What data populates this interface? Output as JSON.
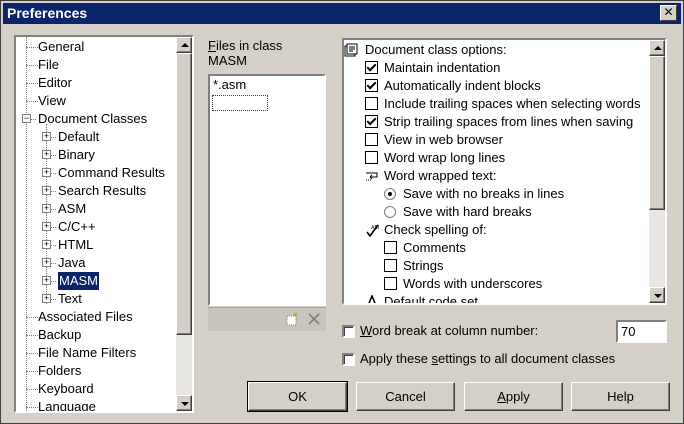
{
  "window": {
    "title": "Preferences",
    "close_glyph": "✕"
  },
  "tree": {
    "items": [
      {
        "label": "General",
        "level": 0,
        "expander": false
      },
      {
        "label": "File",
        "level": 0,
        "expander": false
      },
      {
        "label": "Editor",
        "level": 0,
        "expander": false
      },
      {
        "label": "View",
        "level": 0,
        "expander": false
      },
      {
        "label": "Document Classes",
        "level": 0,
        "expander": "−"
      },
      {
        "label": "Default",
        "level": 1,
        "expander": "+"
      },
      {
        "label": "Binary",
        "level": 1,
        "expander": "+"
      },
      {
        "label": "Command Results",
        "level": 1,
        "expander": "+"
      },
      {
        "label": "Search Results",
        "level": 1,
        "expander": "+"
      },
      {
        "label": "ASM",
        "level": 1,
        "expander": "+"
      },
      {
        "label": "C/C++",
        "level": 1,
        "expander": "+"
      },
      {
        "label": "HTML",
        "level": 1,
        "expander": "+"
      },
      {
        "label": "Java",
        "level": 1,
        "expander": "+"
      },
      {
        "label": "MASM",
        "level": 1,
        "expander": "+",
        "selected": true
      },
      {
        "label": "Text",
        "level": 1,
        "expander": "+"
      },
      {
        "label": "Associated Files",
        "level": 0,
        "expander": false
      },
      {
        "label": "Backup",
        "level": 0,
        "expander": false
      },
      {
        "label": "File Name Filters",
        "level": 0,
        "expander": false
      },
      {
        "label": "Folders",
        "level": 0,
        "expander": false
      },
      {
        "label": "Keyboard",
        "level": 0,
        "expander": false
      },
      {
        "label": "Language",
        "level": 0,
        "expander": false
      }
    ]
  },
  "files": {
    "label_prefix": "",
    "label_accel": "F",
    "label_rest": "iles in class",
    "class_name": "MASM",
    "items": [
      "*.asm"
    ],
    "new_icon": "new-item-icon",
    "delete_icon": "delete-icon"
  },
  "options": {
    "header": "Document class options:",
    "rows": [
      {
        "type": "checkbox",
        "label": "Maintain indentation",
        "checked": true,
        "indent": 1
      },
      {
        "type": "checkbox",
        "label": "Automatically indent blocks",
        "checked": true,
        "indent": 1
      },
      {
        "type": "checkbox",
        "label": "Include trailing spaces when selecting words",
        "checked": false,
        "indent": 1
      },
      {
        "type": "checkbox",
        "label": "Strip trailing spaces from lines when saving",
        "checked": true,
        "indent": 1
      },
      {
        "type": "checkbox",
        "label": "View in web browser",
        "checked": false,
        "indent": 1
      },
      {
        "type": "checkbox",
        "label": "Word wrap long lines",
        "checked": false,
        "indent": 1
      },
      {
        "type": "group",
        "label": "Word wrapped text:",
        "icon": "word-wrap-icon",
        "indent": 1
      },
      {
        "type": "radio",
        "label": "Save with no breaks in lines",
        "checked": true,
        "indent": 2
      },
      {
        "type": "radio",
        "label": "Save with hard breaks",
        "checked": false,
        "indent": 2
      },
      {
        "type": "group",
        "label": "Check spelling of:",
        "icon": "spell-check-icon",
        "indent": 1
      },
      {
        "type": "checkbox",
        "label": "Comments",
        "checked": false,
        "indent": 2
      },
      {
        "type": "checkbox",
        "label": "Strings",
        "checked": false,
        "indent": 2
      },
      {
        "type": "checkbox",
        "label": "Words with underscores",
        "checked": false,
        "indent": 2
      },
      {
        "type": "group",
        "label": "Default code set",
        "icon": "font-icon",
        "indent": 1
      }
    ]
  },
  "word_break": {
    "label_accel": "W",
    "label_rest": "ord break at column number:",
    "checked": false,
    "value": "70"
  },
  "apply_all": {
    "label_before": "Apply these ",
    "label_accel": "s",
    "label_rest": "ettings to all document classes",
    "checked": false
  },
  "buttons": {
    "ok": "OK",
    "cancel": "Cancel",
    "apply_accel": "A",
    "apply_rest": "pply",
    "help": "Help"
  }
}
